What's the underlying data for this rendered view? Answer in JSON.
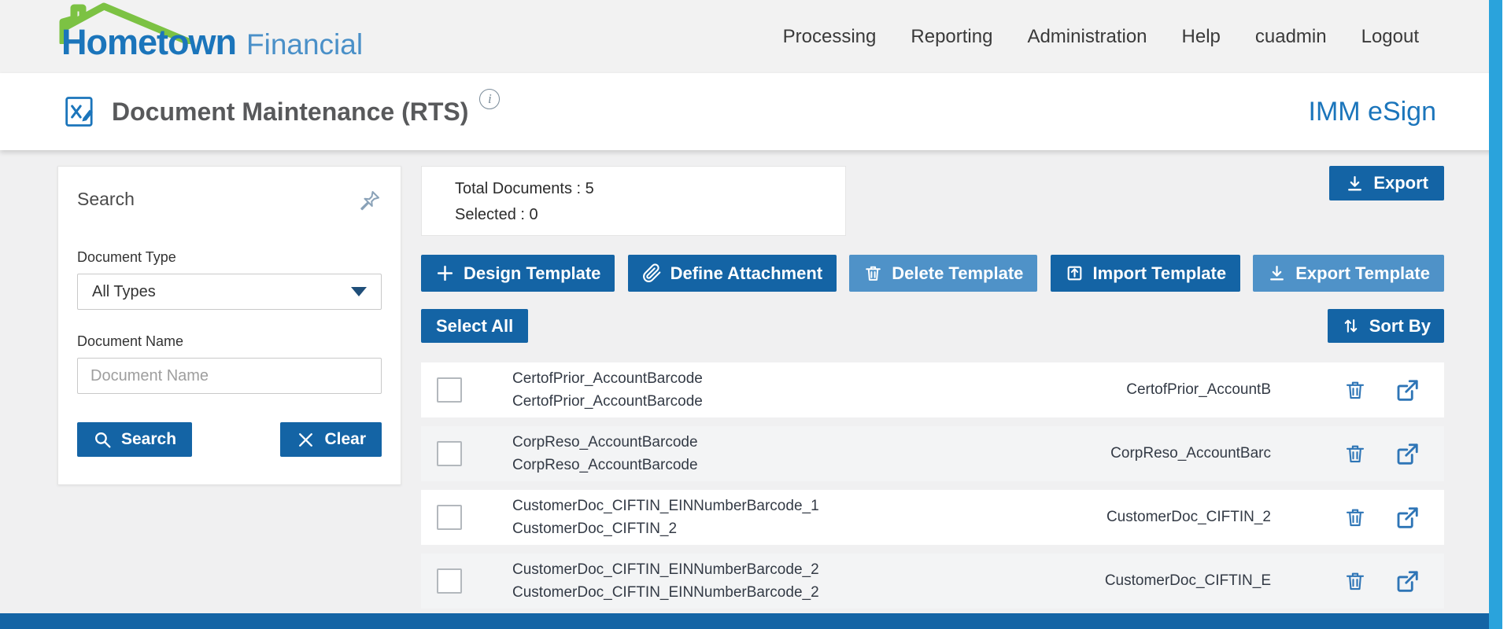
{
  "header": {
    "logo": {
      "bold": "Hometown",
      "light": "Financial"
    },
    "nav_items": [
      "Processing",
      "Reporting",
      "Administration",
      "Help",
      "cuadmin",
      "Logout"
    ]
  },
  "title_bar": {
    "title": "Document Maintenance (RTS)",
    "product": "IMM eSign"
  },
  "search_panel": {
    "title": "Search",
    "document_type_label": "Document Type",
    "document_type_value": "All Types",
    "document_name_label": "Document Name",
    "document_name_placeholder": "Document Name",
    "search_button": "Search",
    "clear_button": "Clear"
  },
  "summary": {
    "total_label": "Total Documents :",
    "total_value": "5",
    "selected_label": "Selected :",
    "selected_value": "0"
  },
  "actions": {
    "export_button": "Export",
    "toolbar": [
      {
        "label": "Design Template",
        "icon": "plus-icon",
        "variant": "dark"
      },
      {
        "label": "Define Attachment",
        "icon": "paperclip-icon",
        "variant": "dark"
      },
      {
        "label": "Delete Template",
        "icon": "trash-icon",
        "variant": "light"
      },
      {
        "label": "Import Template",
        "icon": "import-icon",
        "variant": "dark"
      },
      {
        "label": "Export Template",
        "icon": "download-icon",
        "variant": "light"
      }
    ],
    "select_all_button": "Select All",
    "sort_by_button": "Sort By"
  },
  "documents": [
    {
      "name": "CertofPrior_AccountBarcode",
      "description": "CertofPrior_AccountBarcode",
      "short_name": "CertofPrior_AccountB"
    },
    {
      "name": "CorpReso_AccountBarcode",
      "description": "CorpReso_AccountBarcode",
      "short_name": "CorpReso_AccountBarc"
    },
    {
      "name": "CustomerDoc_CIFTIN_EINNumberBarcode_1",
      "description": "CustomerDoc_CIFTIN_2",
      "short_name": "CustomerDoc_CIFTIN_2"
    },
    {
      "name": "CustomerDoc_CIFTIN_EINNumberBarcode_2",
      "description": "CustomerDoc_CIFTIN_EINNumberBarcode_2",
      "short_name": "CustomerDoc_CIFTIN_E"
    }
  ],
  "colors": {
    "primary_blue": "#1464a5",
    "light_blue": "#4f92c8",
    "brand_blue": "#1b75bb",
    "brand_light_blue": "#4a90c8",
    "brand_green": "#7cc243",
    "accent_strip": "#2aa3dc"
  }
}
